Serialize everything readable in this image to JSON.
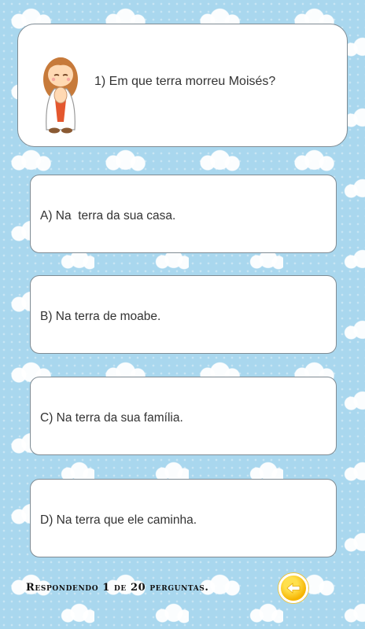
{
  "question": {
    "text": "1) Em que terra morreu Moisés?",
    "icon": "praying-child-mascot"
  },
  "answers": [
    {
      "label": "A) Na  terra da sua casa."
    },
    {
      "label": "B) Na terra de moabe."
    },
    {
      "label": "C) Na terra da sua família."
    },
    {
      "label": "D) Na terra que ele caminha."
    }
  ],
  "footer": {
    "progress": "Respondendo 1 de 20 perguntas.",
    "back_icon": "arrow-left-icon"
  },
  "colors": {
    "background_sky": "#a9d7ee",
    "card": "#ffffff",
    "button_yellow": "#f6b400"
  }
}
